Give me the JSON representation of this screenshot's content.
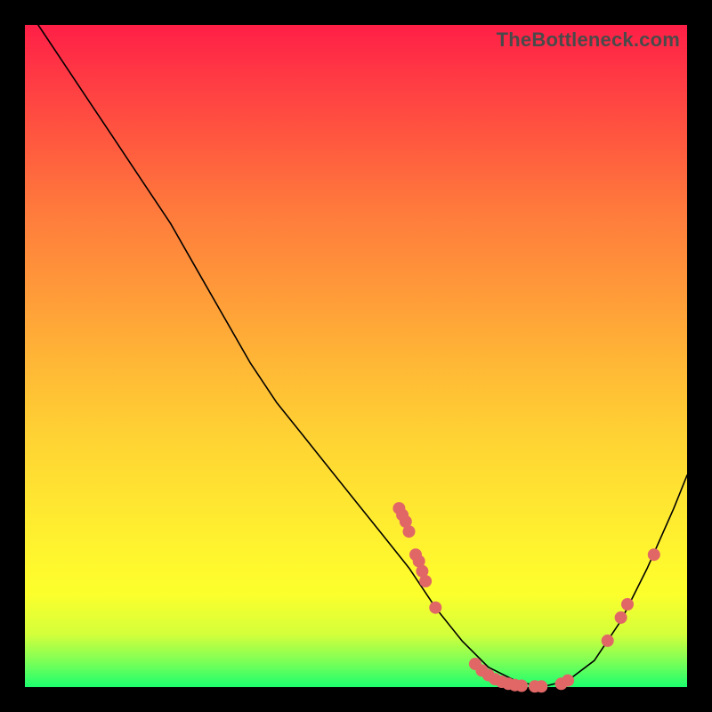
{
  "watermark": "TheBottleneck.com",
  "colors": {
    "point": "#e16767",
    "curve": "#000000",
    "frame_bg_top": "#ff1f47",
    "frame_bg_bottom": "#1cff6e",
    "page_bg": "#000000"
  },
  "chart_data": {
    "type": "line",
    "title": "",
    "xlabel": "",
    "ylabel": "",
    "xlim": [
      0,
      100
    ],
    "ylim": [
      0,
      100
    ],
    "grid": false,
    "legend": false,
    "series": [
      {
        "name": "bottleneck-curve",
        "x": [
          2,
          6,
          10,
          14,
          18,
          22,
          26,
          30,
          34,
          38,
          42,
          46,
          50,
          54,
          58,
          62,
          66,
          70,
          74,
          78,
          82,
          86,
          90,
          94,
          98,
          100
        ],
        "y": [
          100,
          94,
          88,
          82,
          76,
          70,
          63,
          56,
          49,
          43,
          38,
          33,
          28,
          23,
          18,
          12,
          7,
          3,
          1,
          0,
          1,
          4,
          10,
          18,
          27,
          32
        ]
      }
    ],
    "points": [
      {
        "x": 56.5,
        "y": 27
      },
      {
        "x": 57,
        "y": 26
      },
      {
        "x": 57.5,
        "y": 25
      },
      {
        "x": 58,
        "y": 23.5
      },
      {
        "x": 59,
        "y": 20
      },
      {
        "x": 59.5,
        "y": 19
      },
      {
        "x": 60,
        "y": 17.5
      },
      {
        "x": 60.5,
        "y": 16
      },
      {
        "x": 62,
        "y": 12
      },
      {
        "x": 68,
        "y": 3.5
      },
      {
        "x": 69,
        "y": 2.5
      },
      {
        "x": 70,
        "y": 1.8
      },
      {
        "x": 71,
        "y": 1.2
      },
      {
        "x": 72,
        "y": 0.8
      },
      {
        "x": 73,
        "y": 0.5
      },
      {
        "x": 74,
        "y": 0.3
      },
      {
        "x": 75,
        "y": 0.2
      },
      {
        "x": 77,
        "y": 0.1
      },
      {
        "x": 78,
        "y": 0.1
      },
      {
        "x": 81,
        "y": 0.5
      },
      {
        "x": 82,
        "y": 1
      },
      {
        "x": 88,
        "y": 7
      },
      {
        "x": 90,
        "y": 10.5
      },
      {
        "x": 91,
        "y": 12.5
      },
      {
        "x": 95,
        "y": 20
      }
    ]
  }
}
